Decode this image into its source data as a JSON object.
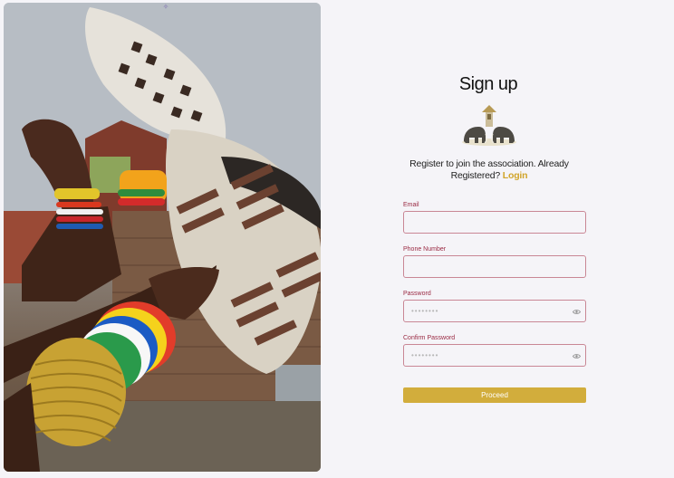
{
  "page": {
    "title": "Sign up",
    "intro_text": "Register to join the association. Already Registered?",
    "login_link": "Login"
  },
  "form": {
    "email_label": "Email",
    "phone_label": "Phone Number",
    "password_label": "Password",
    "password_placeholder": "••••••••",
    "confirm_label": "Confirm Password",
    "confirm_placeholder": "••••••••",
    "proceed_label": "Proceed"
  },
  "icons": {
    "hero_top": "sparkle-icon",
    "password_toggle": "eye-icon",
    "confirm_toggle": "eye-icon",
    "logo": "association-logo"
  },
  "colors": {
    "accent": "#d2ad3c",
    "label": "#9a2a43",
    "input_border": "#c98795",
    "background": "#f5f4f8"
  }
}
